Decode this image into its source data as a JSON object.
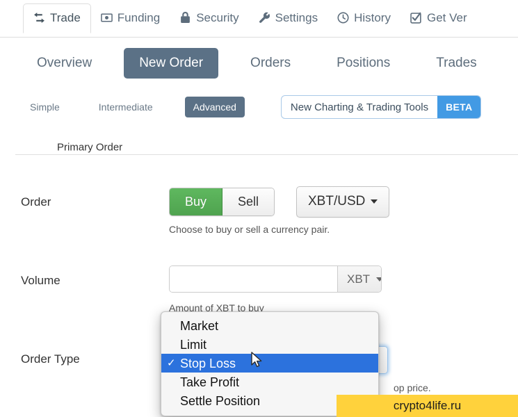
{
  "top_tabs": [
    {
      "label": "Trade",
      "icon": "exchange-icon",
      "active": true
    },
    {
      "label": "Funding",
      "icon": "banknote-icon",
      "active": false
    },
    {
      "label": "Security",
      "icon": "lock-icon",
      "active": false
    },
    {
      "label": "Settings",
      "icon": "wrench-icon",
      "active": false
    },
    {
      "label": "History",
      "icon": "clock-icon",
      "active": false
    },
    {
      "label": "Get Ver",
      "icon": "check-square-icon",
      "active": false
    }
  ],
  "subnav": [
    {
      "label": "Overview",
      "active": false
    },
    {
      "label": "New Order",
      "active": true
    },
    {
      "label": "Orders",
      "active": false
    },
    {
      "label": "Positions",
      "active": false
    },
    {
      "label": "Trades",
      "active": false
    }
  ],
  "modes": [
    {
      "label": "Simple",
      "active": false
    },
    {
      "label": "Intermediate",
      "active": false
    },
    {
      "label": "Advanced",
      "active": true
    }
  ],
  "promo": {
    "label": "New Charting & Trading Tools",
    "badge": "BETA"
  },
  "fieldset": {
    "legend": "Primary Order"
  },
  "order_row": {
    "label": "Order",
    "buy_label": "Buy",
    "sell_label": "Sell",
    "pair_value": "XBT/USD",
    "help": "Choose to buy or sell a currency pair."
  },
  "volume_row": {
    "label": "Volume",
    "value": "",
    "placeholder": "",
    "unit": "XBT",
    "help": "Amount of XBT to buy"
  },
  "order_type_row": {
    "label": "Order Type",
    "help_fragment": "op price."
  },
  "dropdown": {
    "options": [
      {
        "label": "Market",
        "selected": false
      },
      {
        "label": "Limit",
        "selected": false
      },
      {
        "label": "Stop Loss",
        "selected": true
      },
      {
        "label": "Take Profit",
        "selected": false
      },
      {
        "label": "Settle Position",
        "selected": false
      }
    ],
    "check_glyph": "✓"
  },
  "watermark": {
    "text": "crypto4life.ru"
  },
  "colors": {
    "accent_slate": "#5b7186",
    "buy_green": "#5fb85f",
    "beta_blue": "#429ae4",
    "highlight_blue": "#2c72dd",
    "watermark_yellow": "#ffd23c"
  }
}
